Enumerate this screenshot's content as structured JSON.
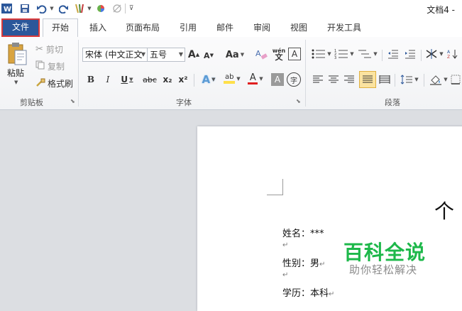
{
  "colors": {
    "file_tab": "#2b579a",
    "file_tab_border": "#d93a3a",
    "watermark_green": "#1db84a",
    "font_color_red": "#e02020",
    "highlight_yellow": "#ffe04a"
  },
  "titlebar": {
    "doc_title": "文档4 -",
    "qat_icons": [
      "word-logo-icon",
      "save-icon",
      "undo-icon",
      "redo-icon",
      "format-painter-icon",
      "color-wheel-icon",
      "eraser-icon",
      "customize-qat-icon"
    ]
  },
  "tabs": [
    "文件",
    "开始",
    "插入",
    "页面布局",
    "引用",
    "邮件",
    "审阅",
    "视图",
    "开发工具"
  ],
  "clipboard": {
    "paste": "粘贴",
    "cut": "剪切",
    "copy": "复制",
    "format_painter": "格式刷",
    "group": "剪贴板"
  },
  "font": {
    "font_name": "宋体 (中文正文",
    "font_size": "五号",
    "grow": "A",
    "shrink": "A",
    "change_case": "Aa",
    "clear_format": "A",
    "phonetic": "wén",
    "border": "A",
    "bold": "B",
    "italic": "I",
    "underline": "U",
    "strike": "abc",
    "subscript": "x₂",
    "superscript": "x²",
    "effects": "A",
    "highlight": "ab",
    "color": "A",
    "shading": "A",
    "enclose": "字",
    "group": "字体"
  },
  "paragraph": {
    "group": "段落"
  },
  "document": {
    "title_char": "个",
    "lines": [
      {
        "label": "姓名：",
        "value": "***"
      },
      {
        "label": "性别：",
        "value": "男"
      },
      {
        "label": "学历：",
        "value": "本科"
      }
    ],
    "para_mark": "↵"
  },
  "watermark": {
    "main": "百科全说",
    "sub": "助你轻松解决"
  }
}
